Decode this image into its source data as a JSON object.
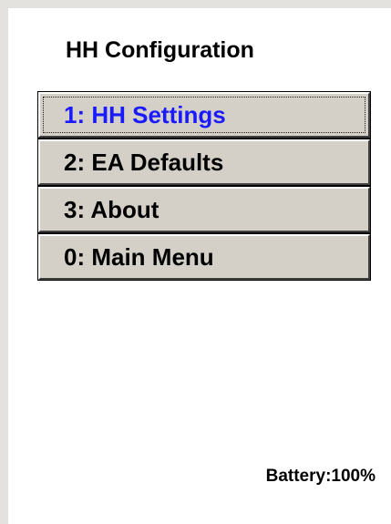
{
  "screen": {
    "title": "HH Configuration"
  },
  "menu": {
    "items": [
      {
        "label": "1: HH Settings",
        "selected": true
      },
      {
        "label": "2: EA Defaults",
        "selected": false
      },
      {
        "label": "3: About",
        "selected": false
      },
      {
        "label": "0: Main Menu",
        "selected": false
      }
    ]
  },
  "status": {
    "battery_text": "Battery:100%"
  },
  "colors": {
    "selected_text": "#1a1aff",
    "button_face": "#d4d0c8",
    "frame": "#e4e2de"
  }
}
